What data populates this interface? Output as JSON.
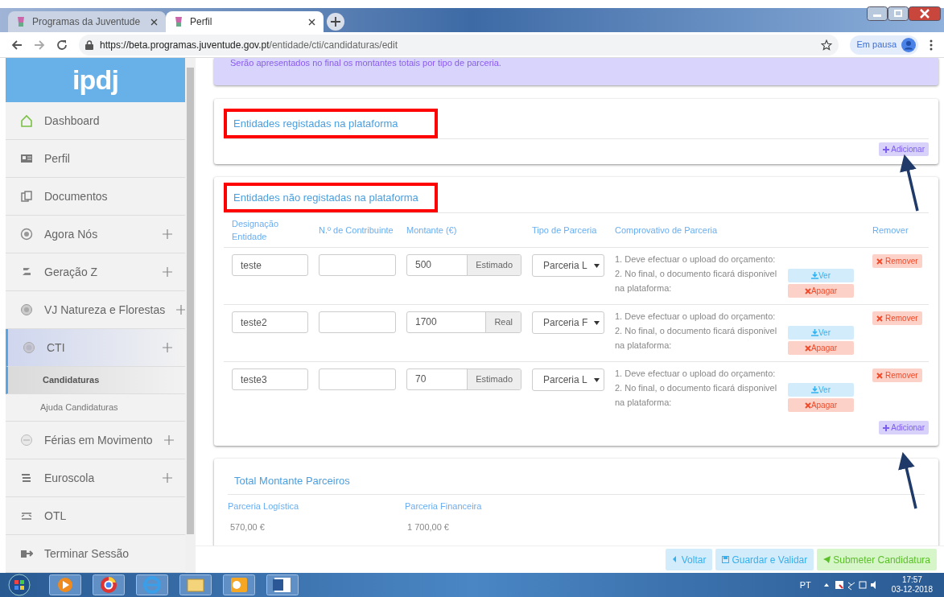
{
  "browser": {
    "tabs": [
      {
        "title": "Programas da Juventude",
        "selected": false
      },
      {
        "title": "Perfil",
        "selected": true
      }
    ],
    "url": {
      "host": "https://beta.programas.juventude.gov.pt",
      "path": "/entidade/cti/candidaturas/edit"
    },
    "profile": "Em pausa"
  },
  "sidebar": {
    "logo": "ipdj",
    "items": [
      {
        "label": "Dashboard",
        "expandable": false,
        "selected": false
      },
      {
        "label": "Perfil",
        "expandable": false,
        "selected": false
      },
      {
        "label": "Documentos",
        "expandable": false,
        "selected": false
      },
      {
        "label": "Agora Nós",
        "expandable": true,
        "selected": false
      },
      {
        "label": "Geração Z",
        "expandable": true,
        "selected": false
      },
      {
        "label": "VJ Natureza e Florestas",
        "expandable": true,
        "selected": false
      },
      {
        "label": "CTI",
        "expandable": true,
        "selected": true,
        "children": [
          {
            "label": "Candidaturas",
            "selected": true
          },
          {
            "label": "Ajuda Candidaturas",
            "selected": false
          }
        ]
      },
      {
        "label": "Férias em Movimento",
        "expandable": true,
        "selected": false
      },
      {
        "label": "Euroscola",
        "expandable": true,
        "selected": false
      },
      {
        "label": "OTL",
        "expandable": false,
        "selected": false
      },
      {
        "label": "Terminar Sessão",
        "expandable": false,
        "selected": false
      }
    ]
  },
  "notice": "Serão apresentados no final os montantes totais por tipo de parceria.",
  "registered": {
    "title": "Entidades registadas na plataforma",
    "add_button": "Adicionar"
  },
  "unregistered": {
    "title": "Entidades não registadas na plataforma",
    "columns": [
      "Designação Entidade",
      "N.º de Contribuinte",
      "Montante (€)",
      "Tipo de Parceria",
      "Comprovativo de Parceria",
      "Remover"
    ],
    "rows": [
      {
        "designacao": "teste",
        "contribuinte": "",
        "montante": "500",
        "montante_tipo": "Estimado",
        "tipo_parceria": "Parceria L",
        "instructions": [
          "1. Deve efectuar o upload do orçamento:",
          "2. No final, o documento ficará disponivel",
          "na plataforma:"
        ],
        "ver": "Ver",
        "apagar": "Apagar",
        "remover": "Remover"
      },
      {
        "designacao": "teste2",
        "contribuinte": "",
        "montante": "1700",
        "montante_tipo": "Real",
        "tipo_parceria": "Parceria F",
        "instructions": [
          "1. Deve efectuar o upload do orçamento:",
          "2. No final, o documento ficará disponivel",
          "na plataforma:"
        ],
        "ver": "Ver",
        "apagar": "Apagar",
        "remover": "Remover"
      },
      {
        "designacao": "teste3",
        "contribuinte": "",
        "montante": "70",
        "montante_tipo": "Estimado",
        "tipo_parceria": "Parceria L",
        "instructions": [
          "1. Deve efectuar o upload do orçamento:",
          "2. No final, o documento ficará disponivel",
          "na plataforma:"
        ],
        "ver": "Ver",
        "apagar": "Apagar",
        "remover": "Remover"
      }
    ],
    "add_button": "Adicionar"
  },
  "totals": {
    "title": "Total Montante Parceiros",
    "columns": [
      {
        "label": "Parceria Logística",
        "value": "570,00 €"
      },
      {
        "label": "Parceria Financeira",
        "value": "1 700,00 €"
      }
    ]
  },
  "footer_buttons": [
    {
      "label": "Voltar",
      "kind": "back"
    },
    {
      "label": "Guardar e Validar",
      "kind": "save"
    },
    {
      "label": "Submeter Candidatura",
      "kind": "submit"
    }
  ],
  "taskbar": {
    "language": "PT",
    "time": "17:57",
    "date": "03-12-2018"
  }
}
